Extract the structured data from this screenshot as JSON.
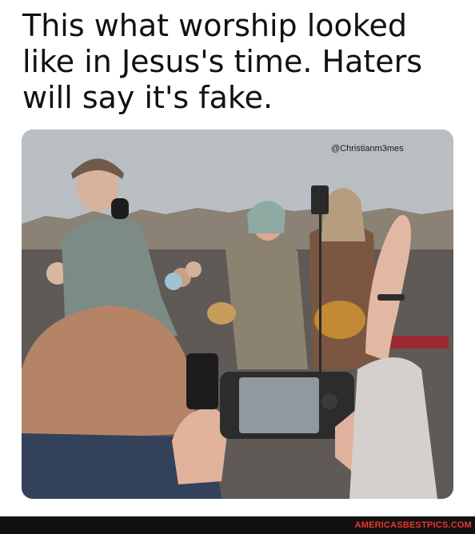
{
  "meme": {
    "caption_lines": [
      "This what worship looked",
      "like in Jesus's time. Haters",
      "will say it's fake."
    ],
    "watermark": "@Christianm3mes"
  },
  "footer": {
    "site_link": "AMERICASBESTPICS.COM"
  },
  "colors": {
    "caption_text": "#111111",
    "footer_background": "#111111",
    "footer_link": "#e8372a"
  }
}
